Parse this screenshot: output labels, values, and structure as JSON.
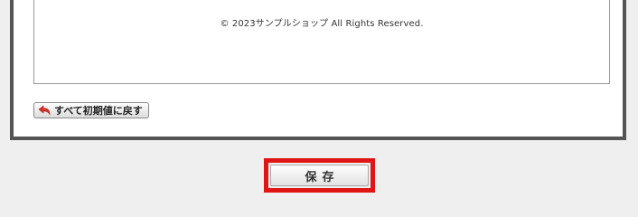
{
  "preview": {
    "footer_text": "© 2023サンプルショップ All Rights Reserved."
  },
  "reset_button": {
    "label": "すべて初期値に戻す",
    "icon": "undo-arrow-icon",
    "icon_color": "#d9342b"
  },
  "save_button": {
    "label": "保存",
    "highlight_color": "#e01515"
  }
}
